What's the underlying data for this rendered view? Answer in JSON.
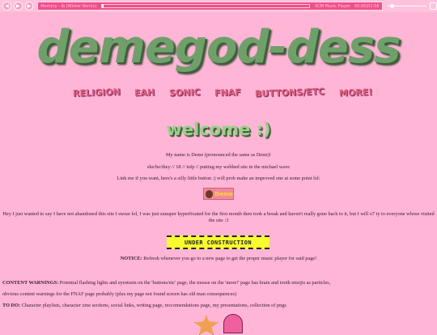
{
  "player": {
    "track": "Memory - Ib (Winter Remix)",
    "name": "SCM Music Player",
    "time": "00:00|02:56",
    "buttons": [
      "prev-icon",
      "play-icon",
      "next-icon"
    ]
  },
  "site_title": "demegod-dess",
  "nav": [
    "RELIGION",
    "EAH",
    "SONIC",
    "FNAF",
    "BUTTONS/ETC",
    "MORE!"
  ],
  "welcome": "welcome :)",
  "intro": [
    "My name is Deme (pronounced the same as Demi)!",
    "she/he/they // 18 // infp // putting my webbed site in the michael wave",
    "Link me if you want, here's a silly little button :) will prob make an improved one at some point lol:"
  ],
  "button_label": "Deme",
  "update": "Hey I just wanted to say I have not abandoned this site I swear lol, I was just suuuper hyperfixated for the first month then took a break and haven't really gone back to it, but I will o7 ty to everyone whose visited the site :3",
  "under_construction": "UNDER CONSTRUCTION",
  "notice": {
    "label": "NOTICE:",
    "text": " Refresh whenever you go to a new page to get the proper music player for said page!"
  },
  "content_warnings": {
    "label": "CONTENT WARNINGS:",
    "text": " Potential flashing lights and eyestrain on the 'buttons/etc' page, the mouse on the 'more!' page has brain and tooth emojis as particles,",
    "text2": "obvious content warnings for the FNAF page probably (plus my page not found screen has old man consequences)"
  },
  "todo": {
    "label": "TO DO:",
    "text": " Character playlists, character zine sections, social links, writing page, reccomendations page, my presentations, collection of pngs"
  }
}
